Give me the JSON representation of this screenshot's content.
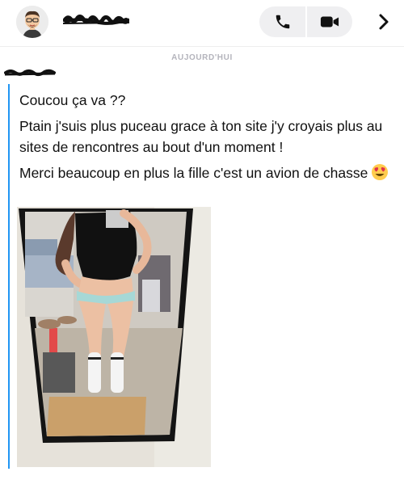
{
  "header": {
    "contact_name": "",
    "call_icon": "phone-icon",
    "video_icon": "video-camera-icon",
    "open_icon": "chevron-right-icon",
    "avatar_icon": "bitmoji-avatar"
  },
  "conversation": {
    "day_label": "AUJOURD'HUI",
    "sender_name": "",
    "accent_color": "#2196f3",
    "messages": [
      {
        "text": "Coucou ça va ??"
      },
      {
        "text": "Ptain j'suis plus puceau grace à ton site j'y croyais plus au sites de rencontres au bout d'un moment !"
      },
      {
        "text": "Merci beaucoup en plus la fille c'est un avion de chasse",
        "emoji": "heart-eyes-emoji"
      }
    ],
    "attachment": {
      "type": "photo",
      "icon": "mirror-selfie-photo"
    }
  }
}
